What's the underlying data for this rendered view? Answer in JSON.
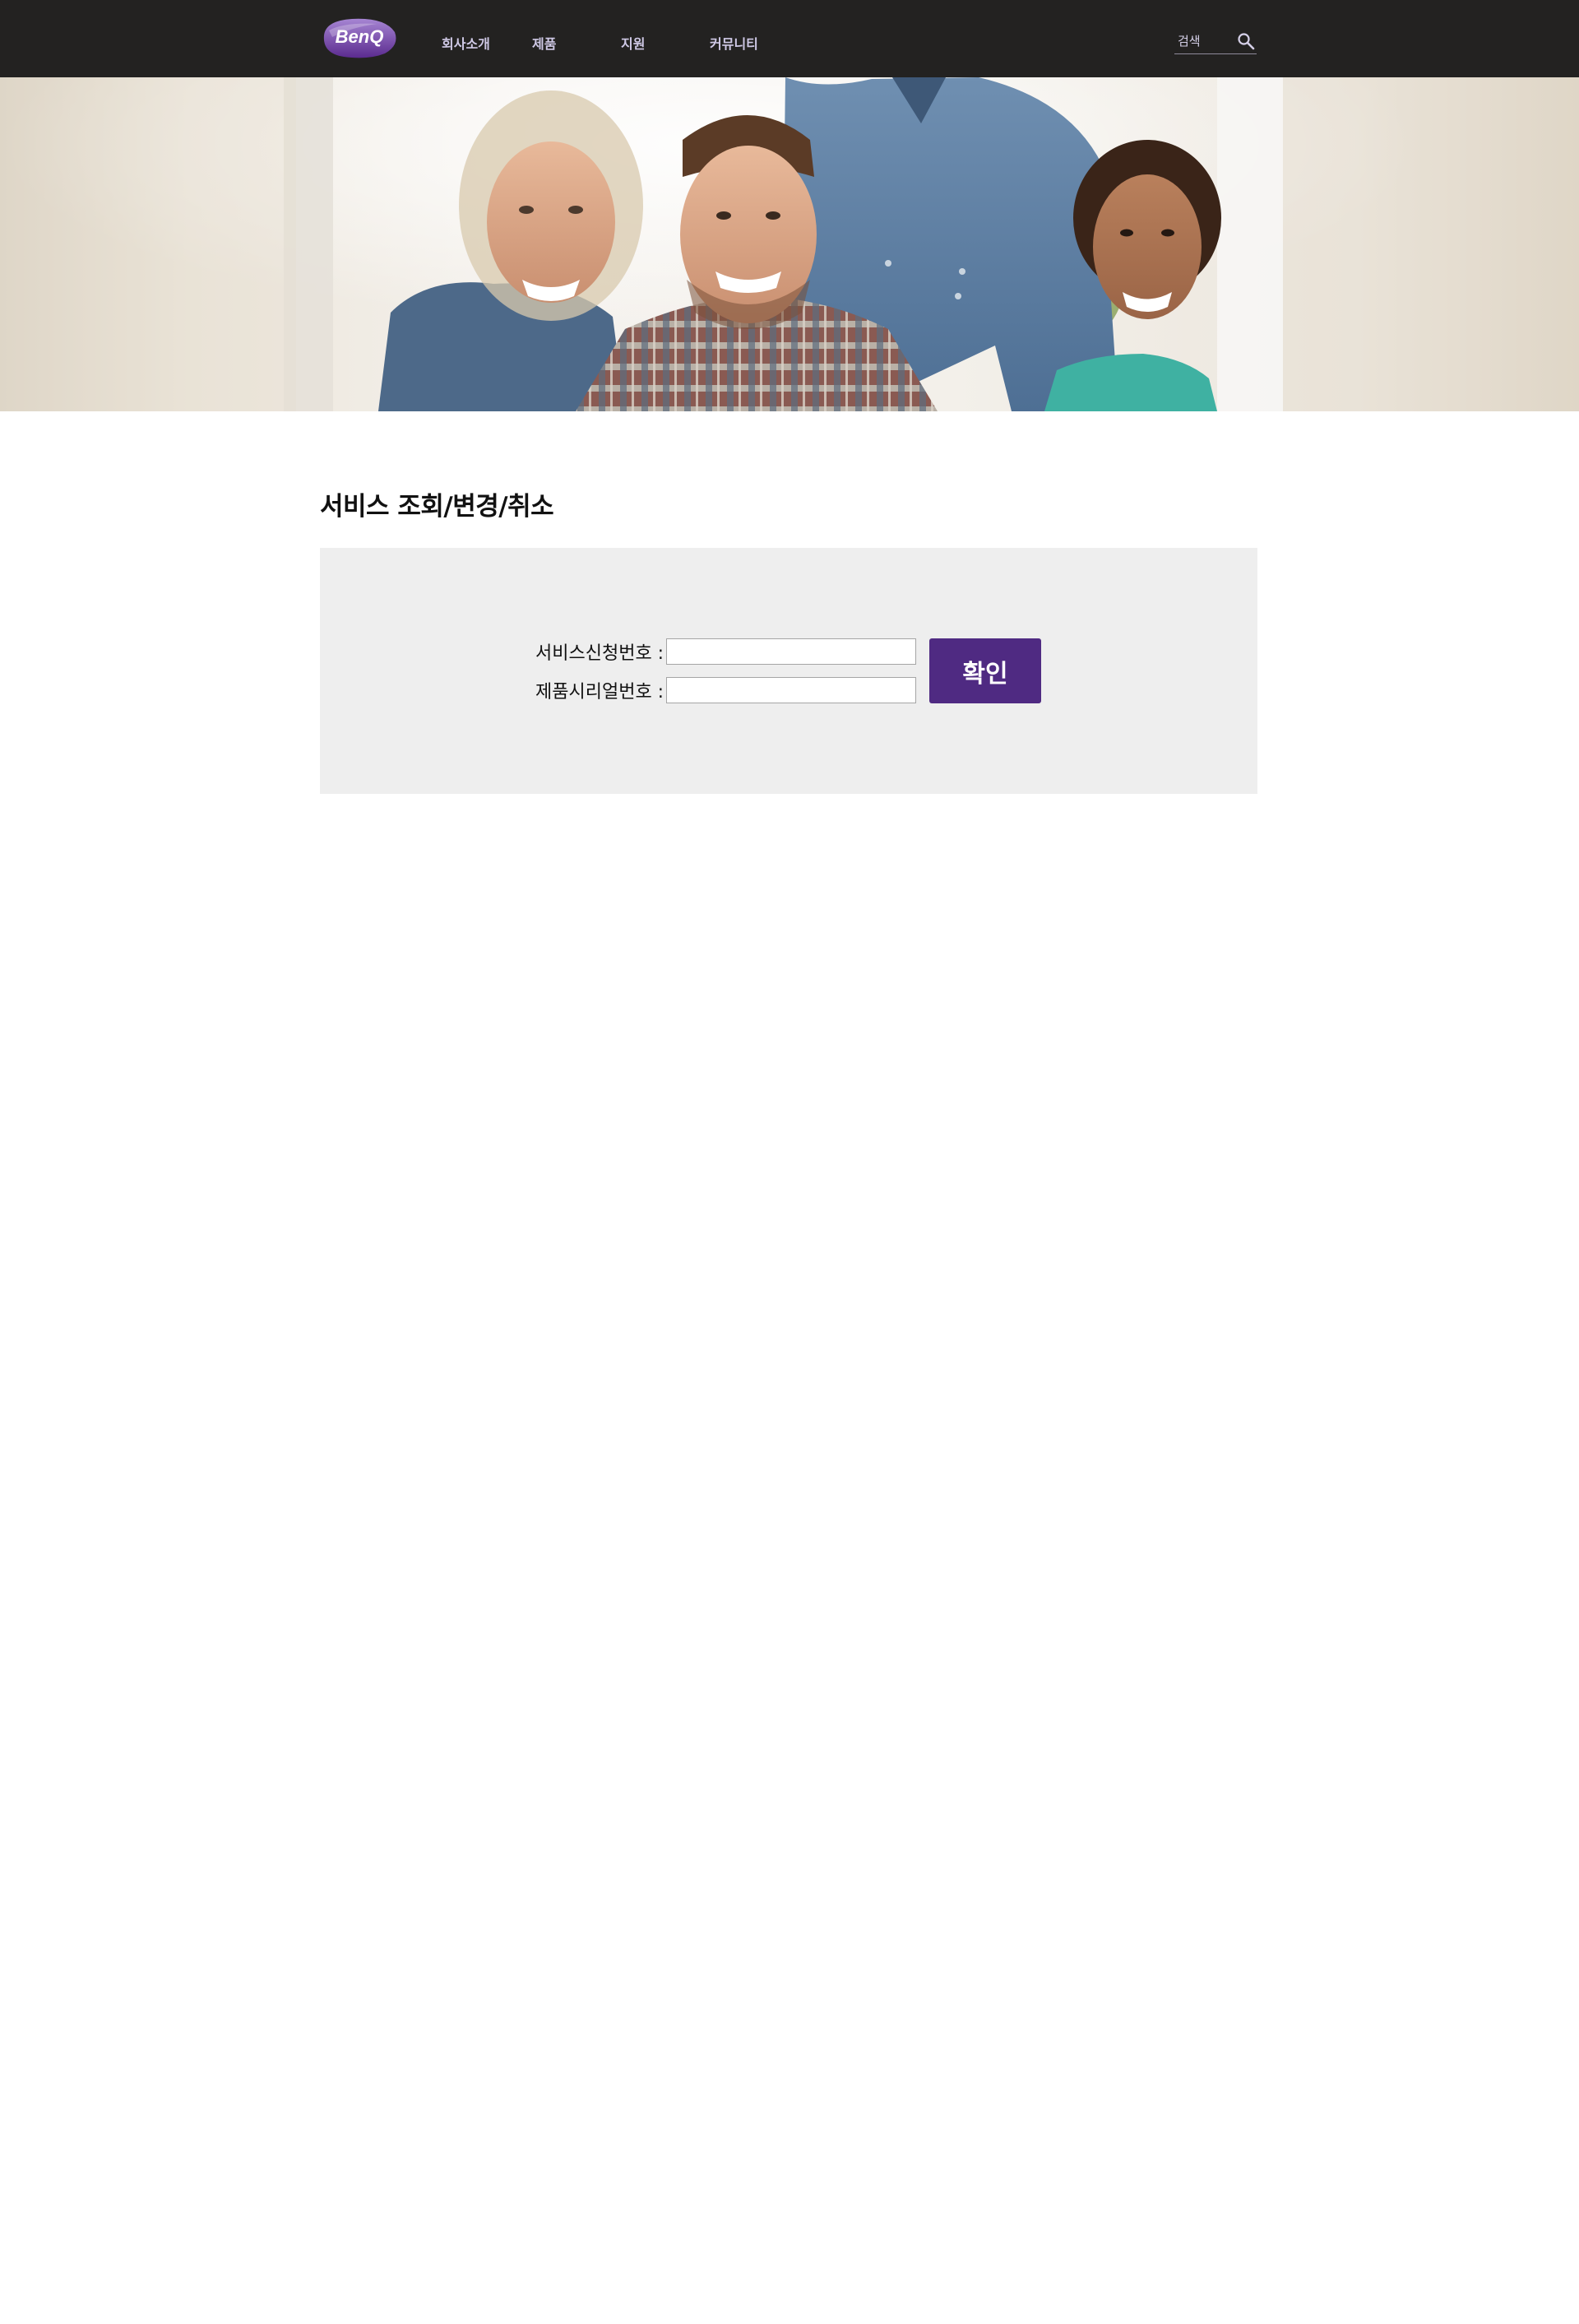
{
  "header": {
    "logo_text": "BenQ",
    "nav": [
      {
        "label": "회사소개"
      },
      {
        "label": "제품"
      },
      {
        "label": "지원"
      },
      {
        "label": "커뮤니티"
      }
    ],
    "search": {
      "placeholder": "검색",
      "icon": "search-icon"
    }
  },
  "hero": {
    "icon": "team-photo-banner"
  },
  "main": {
    "title": "서비스 조회/변경/취소",
    "form": {
      "service_no_label": "서비스신청번호 :",
      "service_no_value": "",
      "serial_no_label": "제품시리얼번호 :",
      "serial_no_value": "",
      "submit_label": "확인"
    }
  },
  "colors": {
    "topbar": "#232221",
    "nav_text": "#cfc9e6",
    "accent_button": "#4f2a82",
    "panel_bg": "#eeeeee"
  }
}
